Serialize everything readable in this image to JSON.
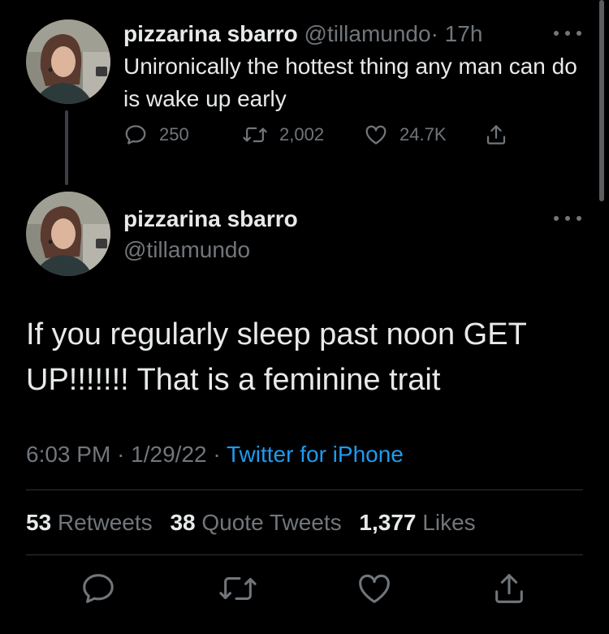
{
  "reply_tweet": {
    "name": "pizzarina sbarro",
    "handle": "@tillamundo",
    "time": "· 17h",
    "text": "Unironically the hottest thing any man can do is wake up early",
    "replies": "250",
    "retweets": "2,002",
    "likes": "24.7K",
    "icons": [
      "reply-icon",
      "retweet-icon",
      "like-icon",
      "share-icon",
      "more-icon"
    ]
  },
  "main_tweet": {
    "name": "pizzarina sbarro",
    "handle": "@tillamundo",
    "text": "If you regularly sleep past noon GET UP!!!!!!! That is a feminine trait",
    "time": "6:03 PM",
    "date": "1/29/22",
    "source": "Twitter for iPhone",
    "stats": {
      "retweets_count": "53",
      "retweets_label": "Retweets",
      "quotes_count": "38",
      "quotes_label": "Quote Tweets",
      "likes_count": "1,377",
      "likes_label": "Likes"
    },
    "action_icons": [
      "reply-icon",
      "retweet-icon",
      "like-icon",
      "share-icon"
    ]
  },
  "colors": {
    "background": "#000000",
    "text": "#e7e9ea",
    "muted": "#71767b",
    "link": "#1d9bf0",
    "divider": "#2f3336"
  }
}
